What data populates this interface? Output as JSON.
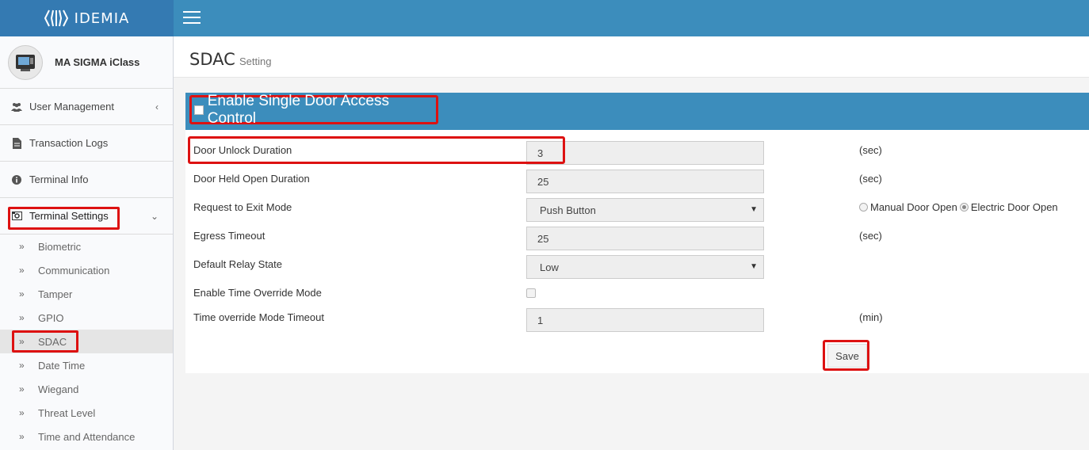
{
  "brand": {
    "name": "IDEMIA"
  },
  "sidebar": {
    "device_name": "MA SIGMA iClass",
    "menu": [
      {
        "label": "User Management",
        "icon": "users-icon"
      },
      {
        "label": "Transaction Logs",
        "icon": "file-icon"
      },
      {
        "label": "Terminal Info",
        "icon": "info-icon"
      },
      {
        "label": "Terminal Settings",
        "icon": "settings-icon"
      }
    ],
    "submenu": [
      "Biometric",
      "Communication",
      "Tamper",
      "GPIO",
      "SDAC",
      "Date Time",
      "Wiegand",
      "Threat Level",
      "Time and Attendance"
    ],
    "selected": "SDAC"
  },
  "header": {
    "title": "SDAC",
    "subtitle": "Setting"
  },
  "panel": {
    "enable_label": "Enable Single Door Access Control",
    "enable_checked": false,
    "fields": {
      "door_unlock": {
        "label": "Door Unlock Duration",
        "value": "3",
        "unit": "(sec)"
      },
      "door_held": {
        "label": "Door Held Open Duration",
        "value": "25",
        "unit": "(sec)"
      },
      "rex_mode": {
        "label": "Request to Exit Mode",
        "value": "Push Button",
        "radio_1": "Manual Door Open",
        "radio_2": "Electric Door Open",
        "selected_radio": "Electric Door Open"
      },
      "egress": {
        "label": "Egress Timeout",
        "value": "25",
        "unit": "(sec)"
      },
      "relay": {
        "label": "Default Relay State",
        "value": "Low"
      },
      "time_override": {
        "label": "Enable Time Override Mode",
        "checked": false
      },
      "override_timeout": {
        "label": "Time override Mode Timeout",
        "value": "1",
        "unit": "(min)"
      }
    },
    "save_label": "Save"
  },
  "colors": {
    "header_blue": "#3c8dbc",
    "logo_blue": "#347ab2",
    "highlight_red": "#dd1111"
  }
}
